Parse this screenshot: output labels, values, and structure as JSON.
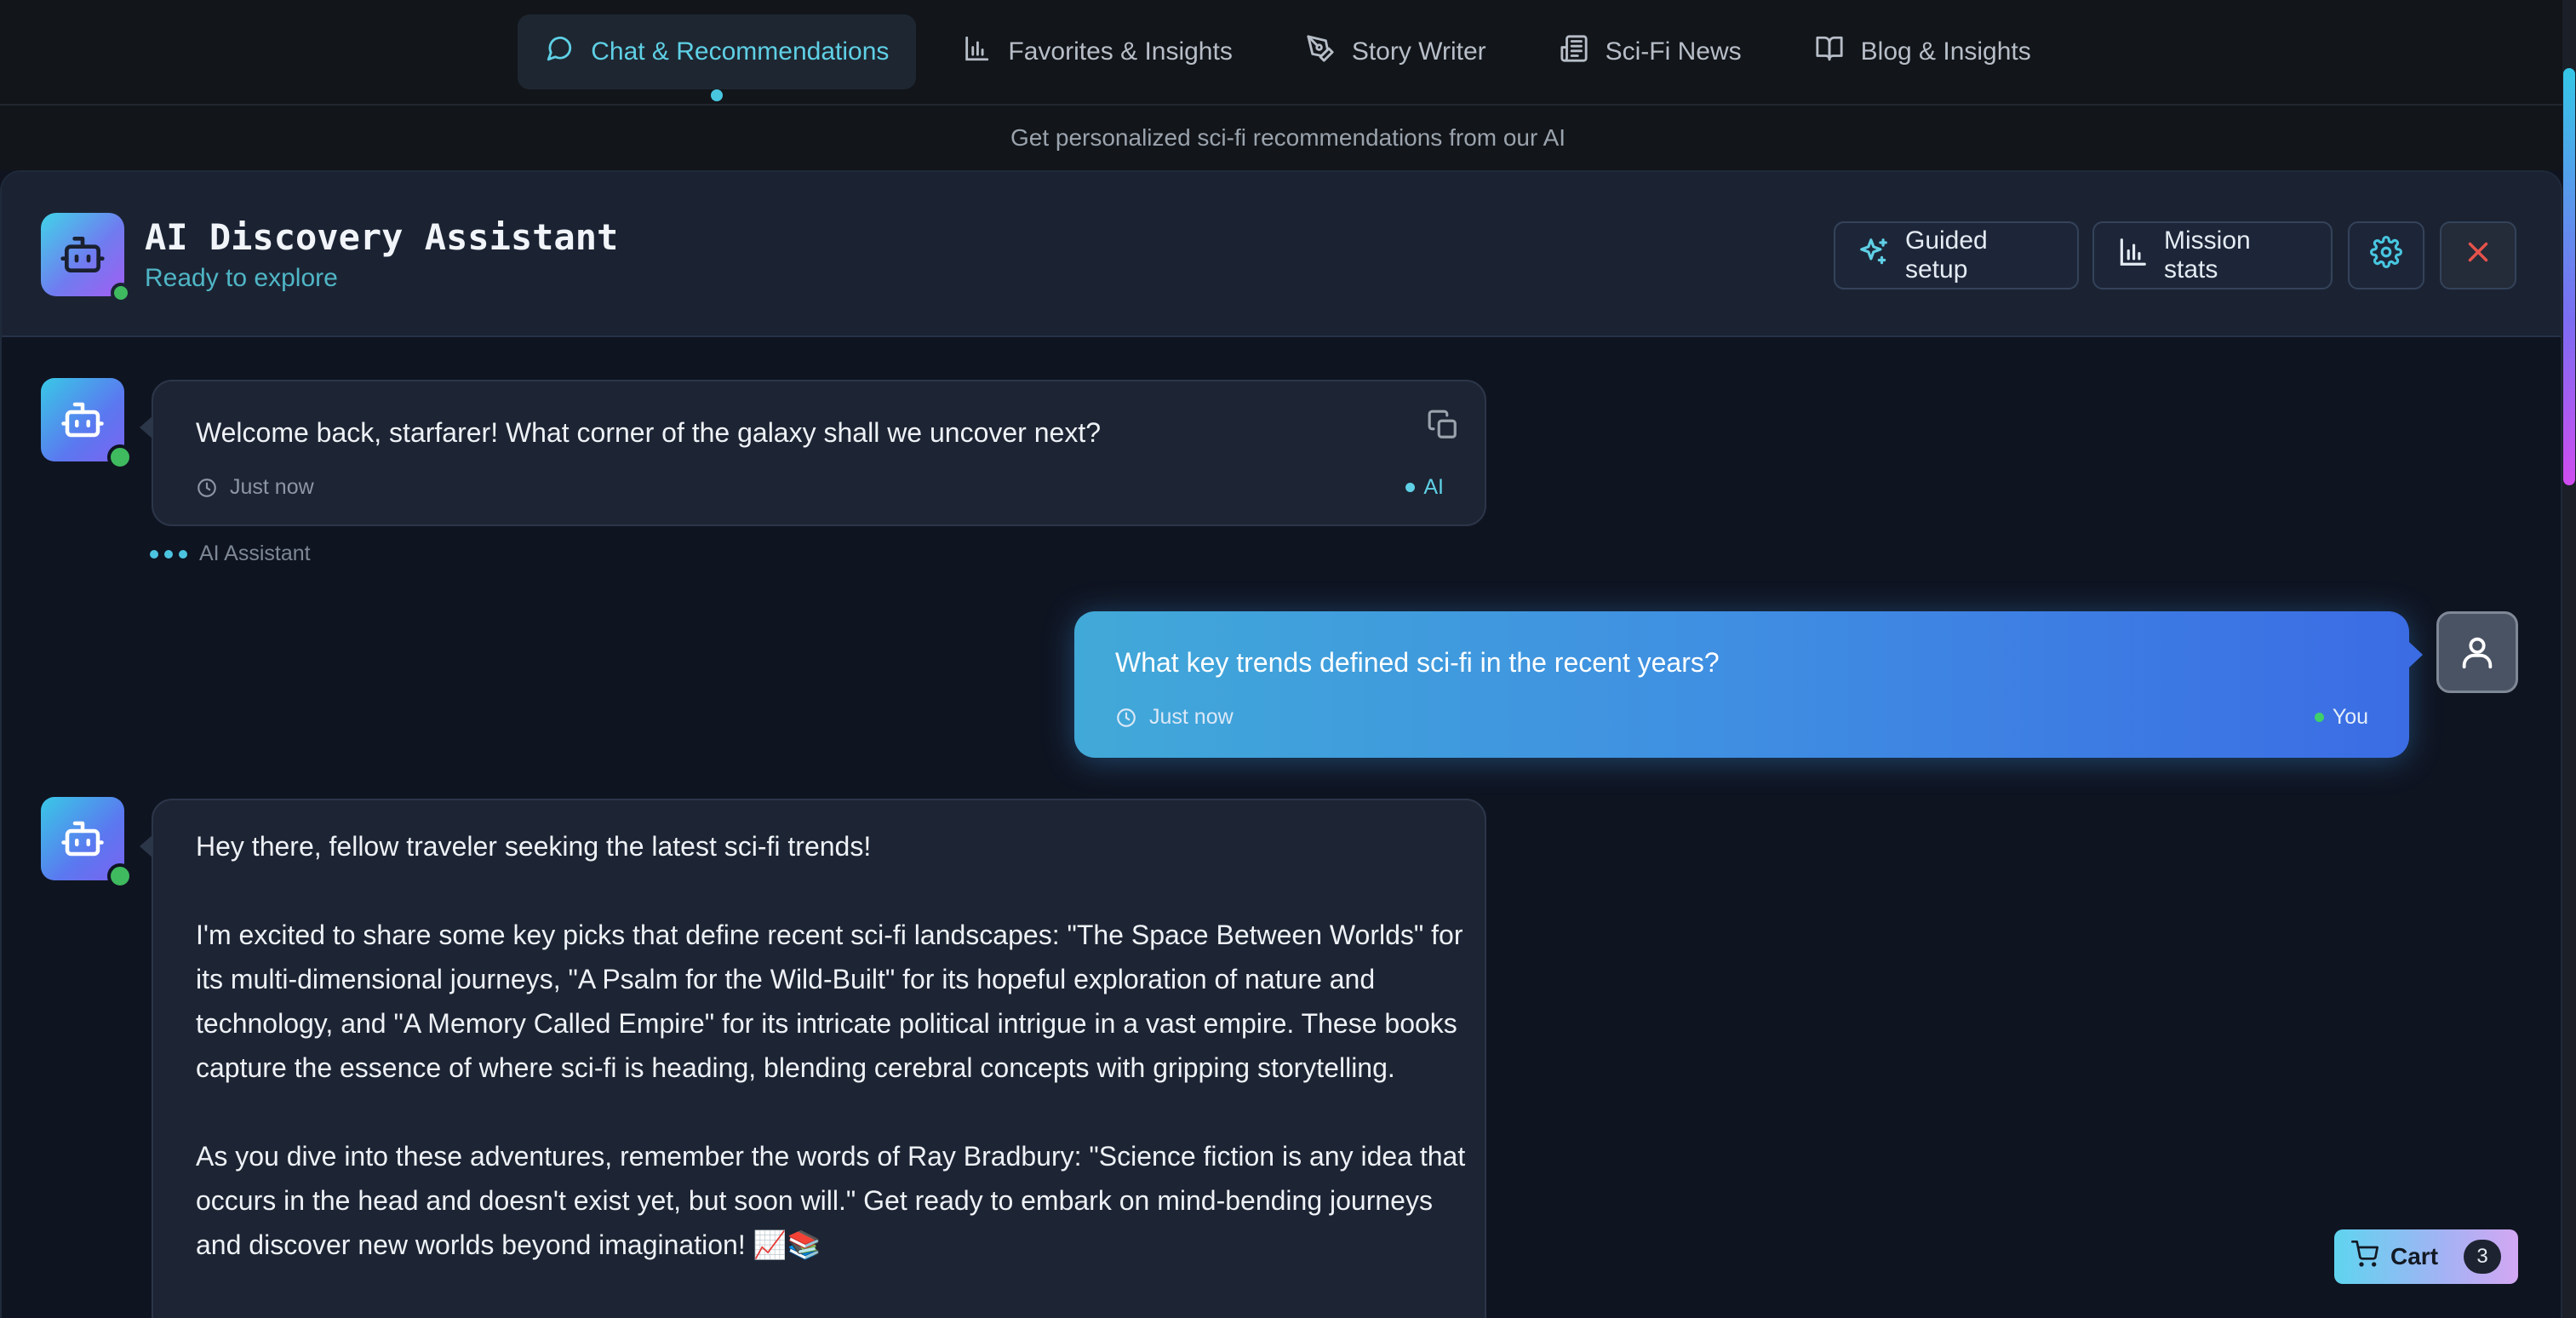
{
  "nav": {
    "tabs": [
      {
        "label": "Chat & Recommendations",
        "icon": "chat-bubble-icon",
        "active": true
      },
      {
        "label": "Favorites & Insights",
        "icon": "bar-chart-icon",
        "active": false
      },
      {
        "label": "Story Writer",
        "icon": "pen-nib-icon",
        "active": false
      },
      {
        "label": "Sci-Fi News",
        "icon": "newspaper-icon",
        "active": false
      },
      {
        "label": "Blog & Insights",
        "icon": "open-book-icon",
        "active": false
      }
    ],
    "subtitle": "Get personalized sci-fi recommendations from our AI"
  },
  "header": {
    "title": "AI Discovery Assistant",
    "status": "Ready to explore",
    "buttons": {
      "guided_setup": "Guided setup",
      "mission_stats": "Mission stats"
    }
  },
  "messages": [
    {
      "role": "bot",
      "text": "Welcome back, starfarer! What corner of the galaxy shall we uncover next?",
      "time": "Just now",
      "tag": "AI"
    },
    {
      "role": "user",
      "text": "What key trends defined sci-fi in the recent years?",
      "time": "Just now",
      "tag": "You"
    },
    {
      "role": "bot",
      "paragraphs": [
        "Hey there, fellow traveler seeking the latest sci-fi trends!",
        "I'm excited to share some key picks that define recent sci-fi landscapes: \"The Space Between Worlds\" for its multi-dimensional journeys, \"A Psalm for the Wild-Built\" for its hopeful exploration of nature and technology, and \"A Memory Called Empire\" for its intricate political intrigue in a vast empire. These books capture the essence of where sci-fi is heading, blending cerebral concepts with gripping storytelling.",
        "As you dive into these adventures, remember the words of Ray Bradbury: \"Science fiction is any idea that occurs in the head and doesn't exist yet, but soon will.\" Get ready to embark on mind-bending journeys and discover new worlds beyond imagination! 📈📚"
      ]
    }
  ],
  "typing_label": "AI Assistant",
  "cart": {
    "label": "Cart",
    "count": "3"
  },
  "colors": {
    "accent_cyan": "#5fd0e6",
    "online_green": "#3fba5f",
    "close_red": "#e5534b",
    "user_bubble": "#3f8ee2"
  }
}
